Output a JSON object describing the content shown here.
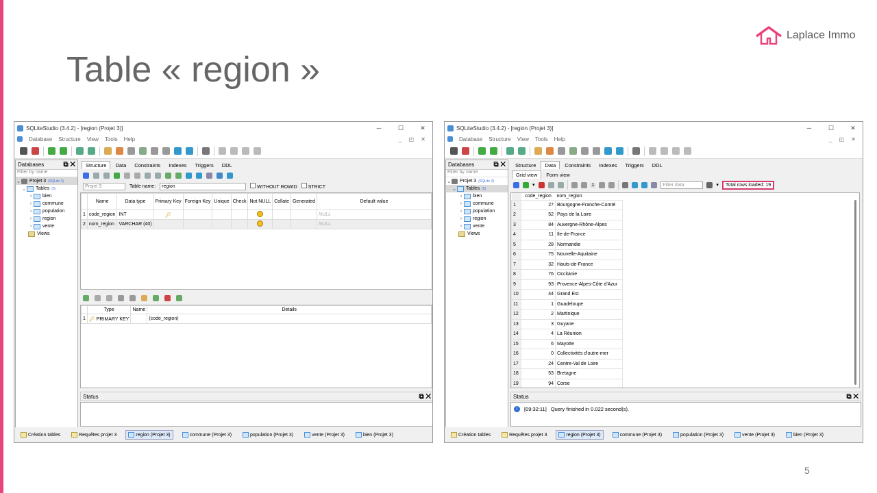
{
  "slide": {
    "title": "Table « region »",
    "page_number": "5",
    "logo_text": "Laplace Immo",
    "accent_color": "#e8457a"
  },
  "window_left": {
    "title": "SQLiteStudio (3.4.2) - [region (Projet 3)]",
    "menu": [
      "Database",
      "Structure",
      "View",
      "Tools",
      "Help"
    ],
    "sidebar": {
      "header": "Databases",
      "filter_placeholder": "Filter by name",
      "db_name": "Projet 3",
      "db_badge": "(SQLite 3)",
      "tables_label": "Tables",
      "tables_count": "(5)",
      "tables": [
        "bien",
        "commune",
        "population",
        "region",
        "vente"
      ],
      "views_label": "Views"
    },
    "tabs": [
      "Structure",
      "Data",
      "Constraints",
      "Indexes",
      "Triggers",
      "DDL"
    ],
    "db_select": "Projet 3",
    "table_name_label": "Table name:",
    "table_name_value": "region",
    "without_rowid": "WITHOUT ROWID",
    "strict": "STRICT",
    "columns_header": [
      "Name",
      "Data type",
      "Primary Key",
      "Foreign Key",
      "Unique",
      "Check",
      "Not NULL",
      "Collate",
      "Generated",
      "Default value"
    ],
    "columns": [
      {
        "n": "1",
        "name": "code_region",
        "type": "INT",
        "default": "NULL"
      },
      {
        "n": "2",
        "name": "nom_region",
        "type": "VARCHAR (40)",
        "default": "NULL"
      }
    ],
    "constraints_header": [
      "Type",
      "Name",
      "Details"
    ],
    "constraints": [
      {
        "n": "1",
        "type": "PRIMARY KEY",
        "name": "",
        "details": "(code_region)"
      }
    ],
    "status_label": "Status",
    "bottom_tabs": [
      "Création tables",
      "Requêtes projet 3",
      "region (Projet 3)",
      "commune (Projet 3)",
      "population (Projet 3)",
      "vente (Projet 3)",
      "bien (Projet 3)"
    ]
  },
  "window_right": {
    "title": "SQLiteStudio (3.4.2) - [region (Projet 3)]",
    "menu": [
      "Database",
      "Structure",
      "View",
      "Tools",
      "Help"
    ],
    "sidebar": {
      "header": "Databases",
      "filter_placeholder": "Filter by name",
      "db_name": "Projet 3",
      "db_badge": "(SQLite 3)",
      "tables_label": "Tables",
      "tables_count": "(5)",
      "tables": [
        "bien",
        "commune",
        "population",
        "region",
        "vente"
      ],
      "views_label": "Views"
    },
    "tabs": [
      "Structure",
      "Data",
      "Constraints",
      "Indexes",
      "Triggers",
      "DDL"
    ],
    "view_tabs": [
      "Grid view",
      "Form view"
    ],
    "page_number": "1",
    "filter_placeholder": "Filter data",
    "total_rows": "Total rows loaded: 19",
    "grid_header": [
      "code_region",
      "nom_region"
    ],
    "rows": [
      {
        "n": "1",
        "code": "27",
        "nom": "Bourgogne-Franche-Comté"
      },
      {
        "n": "2",
        "code": "52",
        "nom": "Pays de la Loire"
      },
      {
        "n": "3",
        "code": "84",
        "nom": "Auvergne-Rhône-Alpes"
      },
      {
        "n": "4",
        "code": "11",
        "nom": "Ile-de-France"
      },
      {
        "n": "5",
        "code": "28",
        "nom": "Normandie"
      },
      {
        "n": "6",
        "code": "75",
        "nom": "Nouvelle-Aquitaine"
      },
      {
        "n": "7",
        "code": "32",
        "nom": "Hauts-de-France"
      },
      {
        "n": "8",
        "code": "76",
        "nom": "Occitanie"
      },
      {
        "n": "9",
        "code": "93",
        "nom": "Provence-Alpes-Côte d'Azur"
      },
      {
        "n": "10",
        "code": "44",
        "nom": "Grand Est"
      },
      {
        "n": "11",
        "code": "1",
        "nom": "Guadeloupe"
      },
      {
        "n": "12",
        "code": "2",
        "nom": "Martinique"
      },
      {
        "n": "13",
        "code": "3",
        "nom": "Guyane"
      },
      {
        "n": "14",
        "code": "4",
        "nom": "La Réunion"
      },
      {
        "n": "15",
        "code": "6",
        "nom": "Mayotte"
      },
      {
        "n": "16",
        "code": "0",
        "nom": "Collectivités d'outre-mer"
      },
      {
        "n": "17",
        "code": "24",
        "nom": "Centre-Val de Loire"
      },
      {
        "n": "18",
        "code": "53",
        "nom": "Bretagne"
      },
      {
        "n": "19",
        "code": "94",
        "nom": "Corse"
      }
    ],
    "status_label": "Status",
    "status_time": "[09:32:11]",
    "status_message": "Query finished in 0.022 second(s).",
    "bottom_tabs": [
      "Création tables",
      "Requêtes projet 3",
      "region (Projet 3)",
      "commune (Projet 3)",
      "population (Projet 3)",
      "vente (Projet 3)",
      "bien (Projet 3)"
    ]
  }
}
